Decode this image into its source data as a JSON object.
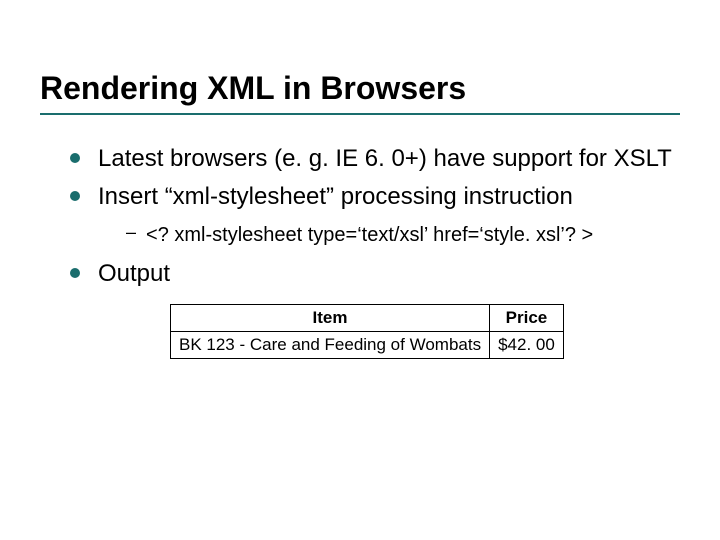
{
  "title": "Rendering XML in Browsers",
  "bullets": {
    "b1": "Latest browsers (e. g. IE 6. 0+) have support for XSLT",
    "b2": "Insert “xml-stylesheet” processing instruction",
    "sub1": "<? xml-stylesheet type=‘text/xsl’ href=‘style. xsl’? >",
    "b3": "Output"
  },
  "table": {
    "headers": {
      "h1": "Item",
      "h2": "Price"
    },
    "rows": {
      "r1": {
        "c1": "BK 123 - Care and Feeding of Wombats",
        "c2": "$42. 00"
      }
    }
  }
}
